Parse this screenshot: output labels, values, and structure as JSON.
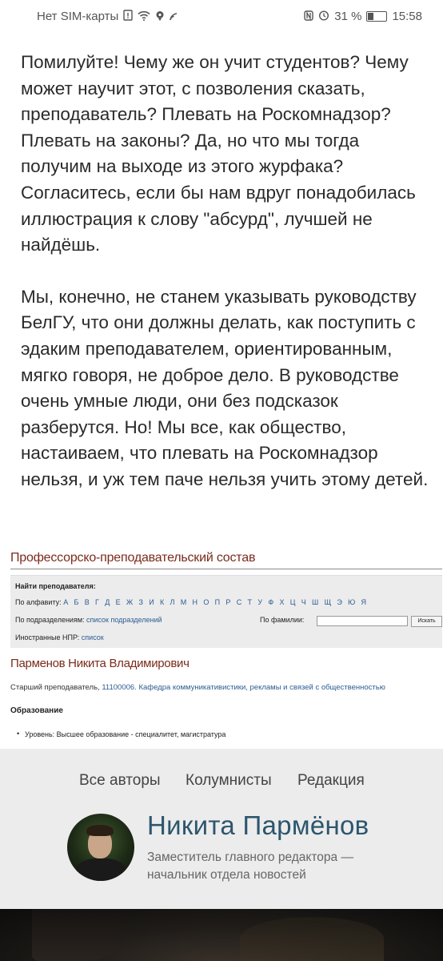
{
  "status_bar": {
    "carrier": "Нет SIM-карты",
    "battery_percent": "31 %",
    "time": "15:58",
    "icons": [
      "sim-alert-icon",
      "wifi-icon",
      "hotspot-icon",
      "signal-icon",
      "nfc-icon",
      "alarm-icon",
      "battery-icon"
    ]
  },
  "article": {
    "paragraphs": [
      "Помилуйте! Чему же он учит студентов? Чему может научит этот, с позволения сказать, преподаватель? Плевать на Роскомнадзор? Плевать на законы? Да, но что мы тогда получим на выходе из этого журфака? Согласитесь, если бы нам вдруг понадобилась иллюстрация к слову \"абсурд\", лучшей не найдёшь.",
      "Мы, конечно, не станем указывать руководству БелГУ, что они должны делать, как поступить с эдаким преподавателем, ориентированным, мягко говоря, не доброе дело. В руководстве очень умные люди, они без подсказок разберутся. Но! Мы все, как общество, настаиваем, что плевать на Роскомнадзор нельзя, и уж тем паче нельзя учить этому детей."
    ]
  },
  "screenshot": {
    "title": "Профессорско-преподавательский состав",
    "find": {
      "heading": "Найти преподавателя:",
      "alphabet_label": "По алфавиту:",
      "alphabet": "А Б В Г Д Е Ж З И К Л М Н О П Р С Т У Ф Х Ц Ч Ш Щ Э Ю Я",
      "division_label": "По подразделениям:",
      "division_link": "список подразделений",
      "surname_label": "По фамилии:",
      "search_button": "Искать",
      "foreign_label": "Иностранные НПР:",
      "foreign_link": "список"
    },
    "person": {
      "name": "Парменов Никита Владимирович",
      "position_prefix": "Старший преподаватель,",
      "position_link": "11100006. Кафедра коммуникативистики, рекламы и связей с общественностью",
      "education_heading": "Образование",
      "education_item": "Уровень: Высшее образование - специалитет, магистратура"
    }
  },
  "author_card": {
    "nav": [
      "Все авторы",
      "Колумнисты",
      "Редакция"
    ],
    "name": "Никита Пармёнов",
    "role_line1": "Заместитель главного редактора —",
    "role_line2": "начальник отдела новостей"
  },
  "colors": {
    "link": "#2d5b93",
    "heading_brown": "#7a2b1c",
    "author_name": "#2d566e",
    "card_bg": "#ececec"
  }
}
